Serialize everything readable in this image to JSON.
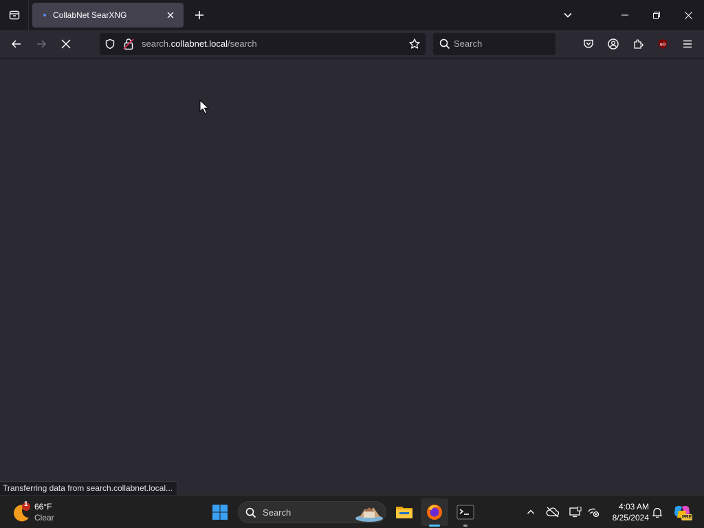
{
  "browser": {
    "tab": {
      "title": "CollabNet SearXNG"
    },
    "url": {
      "prefix": "search.",
      "host": "collabnet.local",
      "path": "/search"
    },
    "search_placeholder": "Search",
    "status_text": "Transferring data from search.collabnet.local..."
  },
  "taskbar": {
    "weather": {
      "temp": "66°F",
      "condition": "Clear",
      "badge": "1"
    },
    "search_placeholder": "Search",
    "time": "4:03 AM",
    "date": "8/25/2024",
    "pre_badge": "PRE"
  },
  "colors": {
    "page_bg": "#2b2a33",
    "tab_bg": "#1c1b22",
    "active_tab": "#42414d",
    "taskbar_bg": "#202020",
    "accent": "#4cc2ff"
  }
}
